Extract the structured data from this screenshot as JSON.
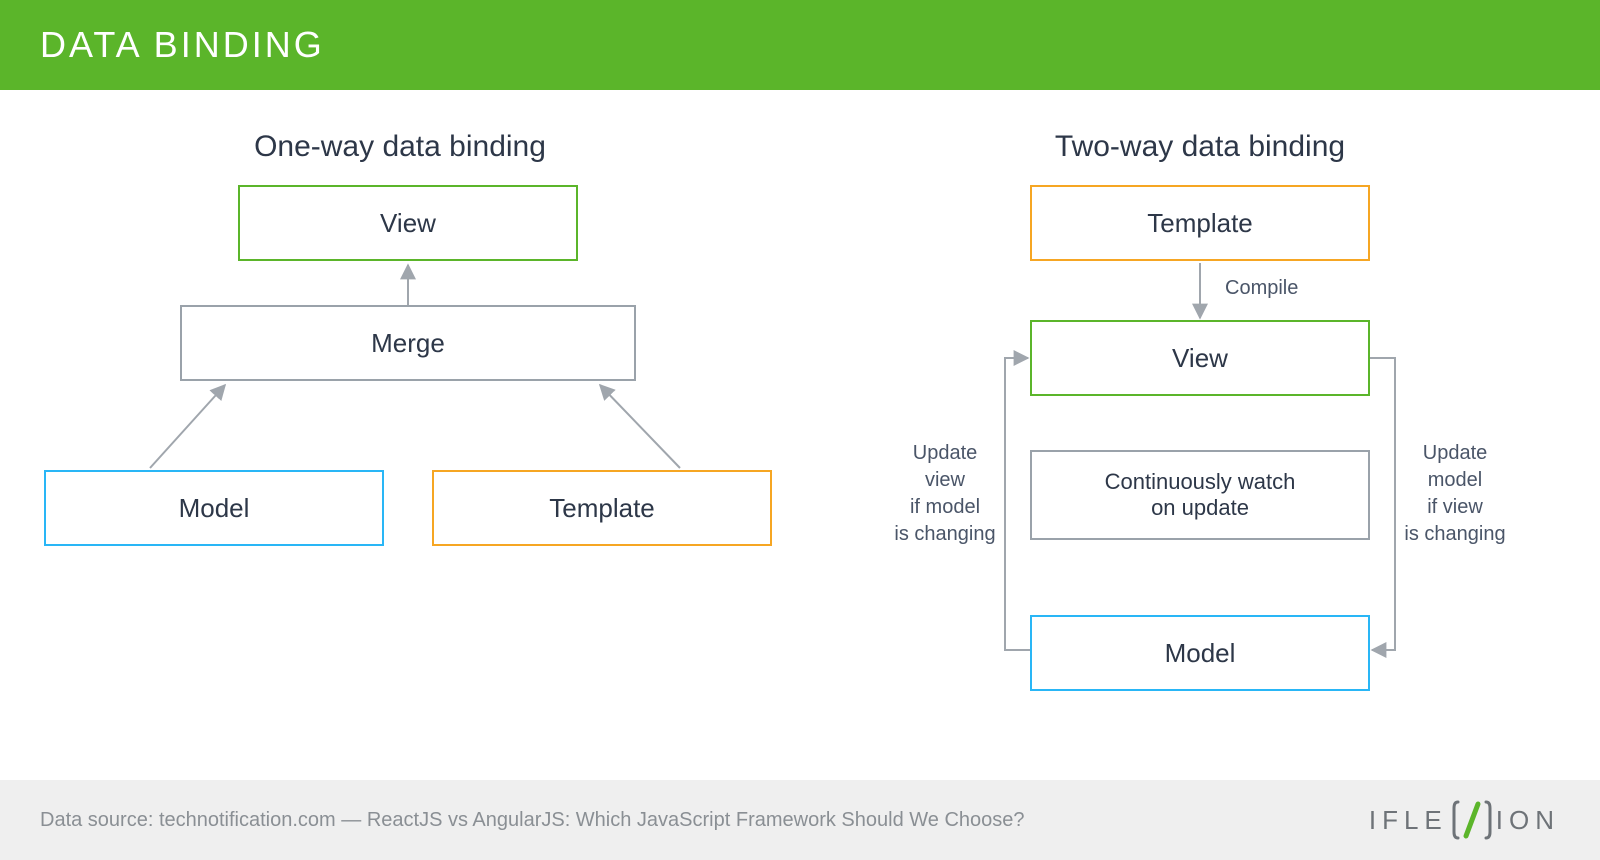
{
  "header": {
    "title": "DATA BINDING"
  },
  "left": {
    "title": "One-way data binding",
    "boxes": {
      "view": "View",
      "merge": "Merge",
      "model": "Model",
      "template": "Template"
    }
  },
  "right": {
    "title": "Two-way data binding",
    "boxes": {
      "template": "Template",
      "view": "View",
      "watch": "Continuously watch\non update",
      "model": "Model"
    },
    "labels": {
      "compile": "Compile",
      "update_view": "Update\nview\nif model\nis changing",
      "update_model": "Update\nmodel\nif view\nis changing"
    }
  },
  "footer": {
    "source": "Data source: technotification.com — ReactJS vs AngularJS: Which JavaScript Framework Should We Choose?",
    "brand_left": "IFLE",
    "brand_right": "ION"
  },
  "colors": {
    "green": "#5bb52a",
    "gray": "#9aa2aa",
    "blue": "#29b6f6",
    "orange": "#f6a623",
    "arrow": "#a0a6ad"
  }
}
